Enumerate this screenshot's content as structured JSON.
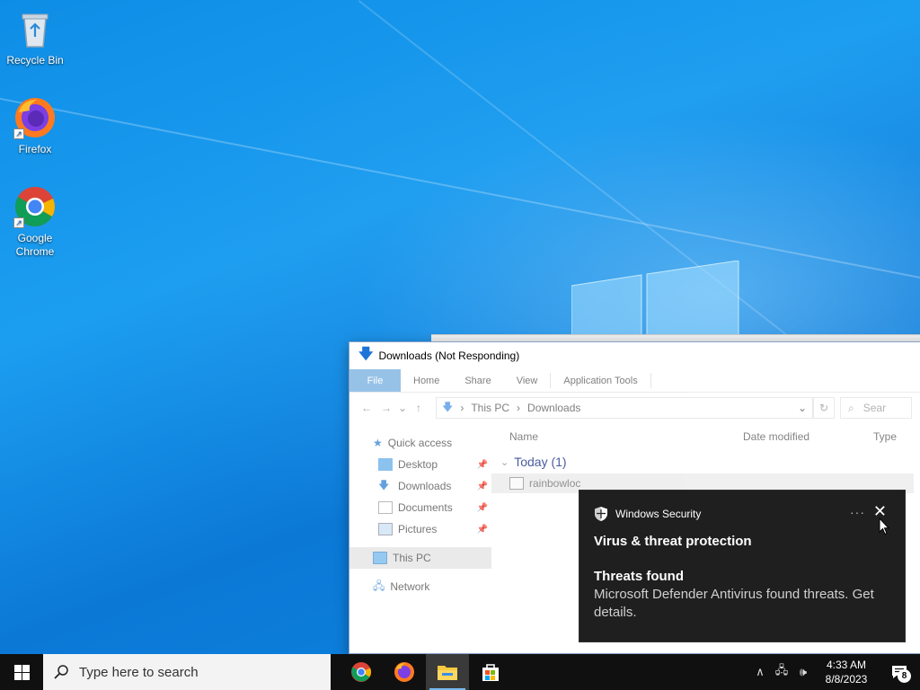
{
  "desktop": {
    "icons": [
      {
        "label": "Recycle Bin",
        "icon": "recycle-bin-icon"
      },
      {
        "label": "Firefox",
        "icon": "firefox-icon"
      },
      {
        "label": "Google Chrome",
        "icon": "chrome-icon"
      }
    ]
  },
  "explorer": {
    "title": "Downloads (Not Responding)",
    "ribbon_tabs": [
      "File",
      "Home",
      "Share",
      "View",
      "Application Tools"
    ],
    "address": {
      "segments": [
        "This PC",
        "Downloads"
      ],
      "search_placeholder": "Sear"
    },
    "nav_pane": {
      "quick_access": "Quick access",
      "pinned": [
        "Desktop",
        "Downloads",
        "Documents",
        "Pictures"
      ],
      "this_pc": "This PC",
      "network": "Network"
    },
    "columns": [
      "Name",
      "Date modified",
      "Type"
    ],
    "group": "Today (1)",
    "files": [
      {
        "name": "rainbowloc"
      }
    ]
  },
  "toast": {
    "app": "Windows Security",
    "title": "Virus & threat protection",
    "subtitle": "Threats found",
    "message": "Microsoft Defender Antivirus found threats. Get details.",
    "more": "···",
    "close": "✕"
  },
  "taskbar": {
    "search_placeholder": "Type here to search",
    "apps": [
      "chrome-icon",
      "firefox-icon",
      "file-explorer-icon",
      "store-icon"
    ],
    "time": "4:33 AM",
    "date": "8/8/2023",
    "notification_count": "8"
  },
  "colors": {
    "taskbar": "#101010",
    "toast_bg": "#1f1f1f",
    "accent": "#1979ca"
  }
}
